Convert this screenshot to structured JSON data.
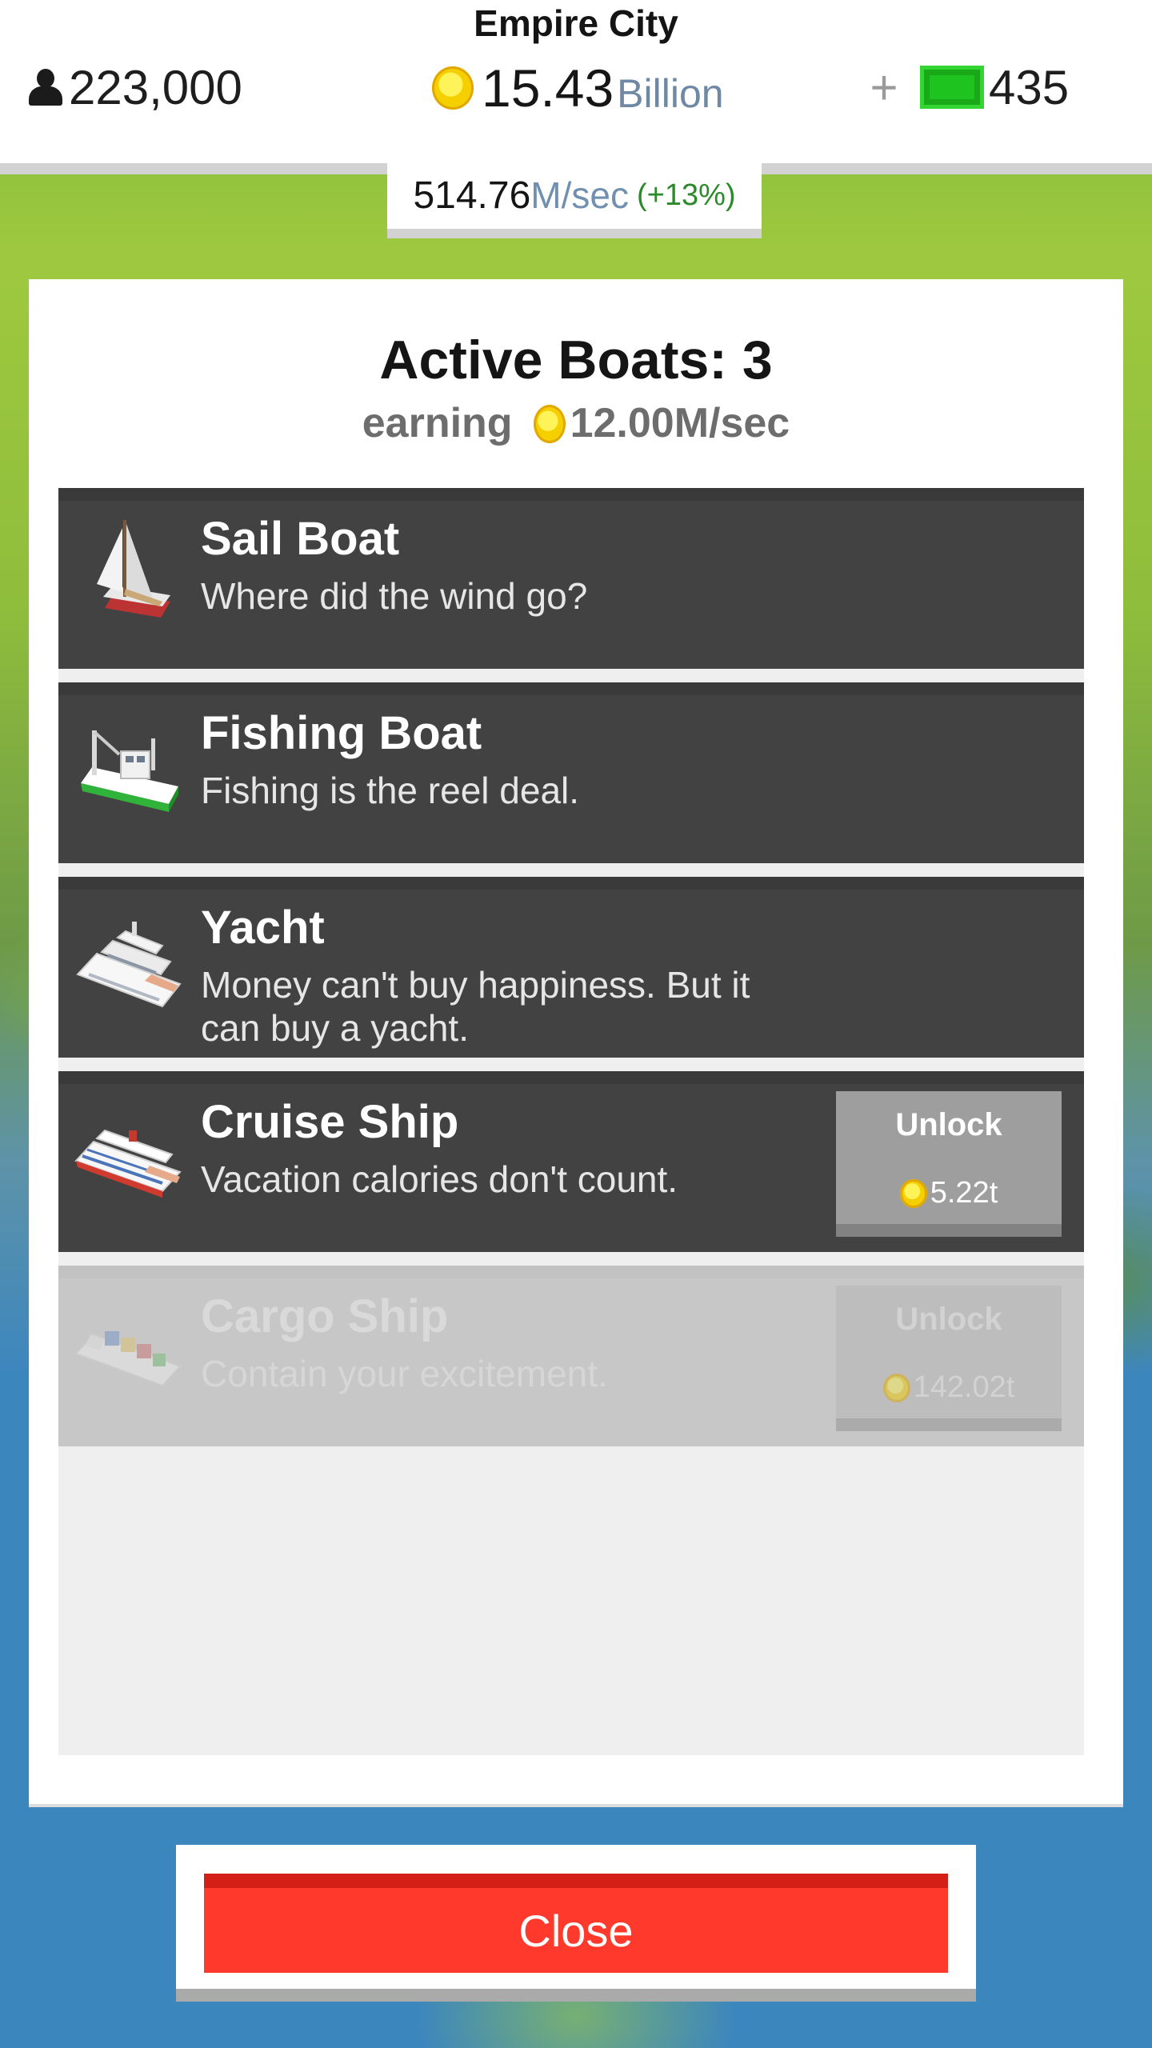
{
  "header": {
    "city_name": "Empire City",
    "population": "223,000",
    "money_amount": "15.43",
    "money_unit": "Billion",
    "plus_label": "+",
    "cash": "435",
    "rate": "514.76",
    "rate_unit": "M/sec",
    "rate_bonus": "(+13%)"
  },
  "dialog": {
    "title": "Active Boats: 3",
    "earning_label": "earning",
    "earning_value": "12.00M/sec"
  },
  "boats": [
    {
      "name": "Sail Boat",
      "description": "Where did the wind go?",
      "icon": "sailboat-icon"
    },
    {
      "name": "Fishing Boat",
      "description": "Fishing is the reel deal.",
      "icon": "fishing-boat-icon"
    },
    {
      "name": "Yacht",
      "description": "Money can't buy happiness. But it can buy a yacht.",
      "icon": "yacht-icon"
    },
    {
      "name": "Cruise Ship",
      "description": "Vacation calories don't count.",
      "icon": "cruise-ship-icon",
      "unlock_label": "Unlock",
      "unlock_price": "5.22t"
    },
    {
      "name": "Cargo Ship",
      "description": "Contain your excitement.",
      "icon": "cargo-ship-icon",
      "unlock_label": "Unlock",
      "unlock_price": "142.02t"
    }
  ],
  "footer": {
    "close_label": "Close"
  },
  "colors": {
    "close_button": "#ff3a2d",
    "row_dark": "#424242",
    "cash_green": "#1fc31f",
    "coin_yellow": "#f5cf00"
  }
}
